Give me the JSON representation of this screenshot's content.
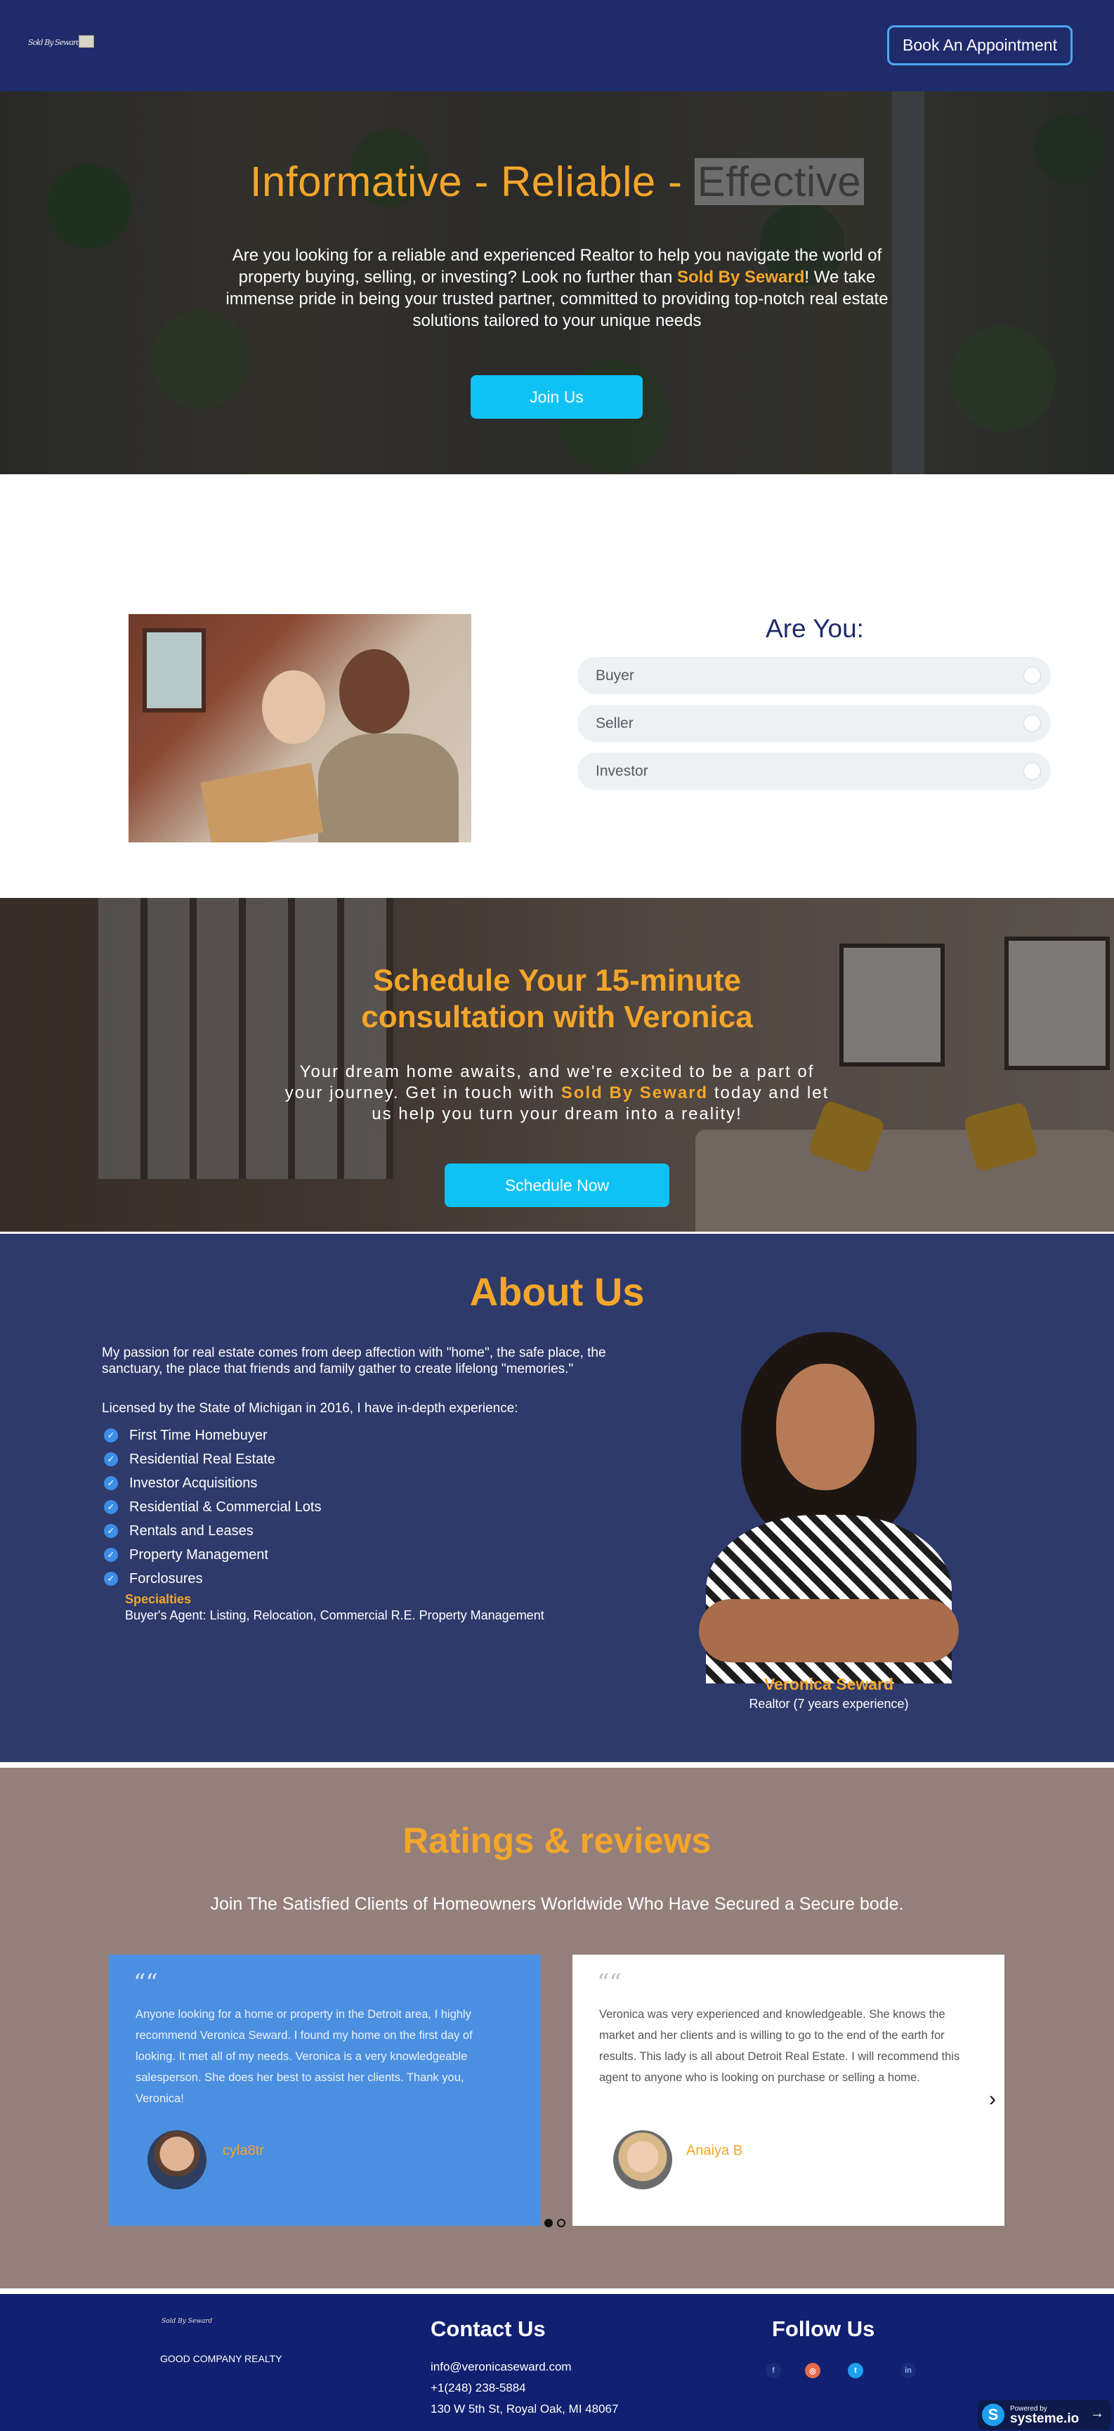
{
  "header": {
    "logo_text": "Sold By Seward",
    "book_label": "Book An Appointment"
  },
  "hero": {
    "title_part1": "Informative - Reliable - ",
    "title_highlight": "Effective",
    "text_before": "Are you looking for a reliable and experienced Realtor to help you navigate the world of property buying, selling, or investing? Look no further than ",
    "brand": "Sold By Seward",
    "text_after": "! We take immense pride in being your trusted partner, committed to providing top-notch real estate solutions tailored to your unique needs",
    "join_label": "Join Us"
  },
  "are_you": {
    "title": "Are You:",
    "options": [
      "Buyer",
      "Seller",
      "Investor"
    ]
  },
  "schedule": {
    "title_line1": "Schedule Your 15-minute",
    "title_line2": "consultation with Veronica",
    "text_before": "Your dream home awaits, and we're excited to be a part of your journey. Get in touch with ",
    "brand": "Sold By Seward",
    "text_after": " today and let us help you turn your dream into a reality!",
    "button_label": "Schedule Now"
  },
  "about": {
    "title": "About Us",
    "paragraph": "My passion for real estate comes from deep affection with \"home\", the safe place, the sanctuary, the place that friends and family gather to create lifelong \"memories.\"",
    "licensed": "Licensed by the State of Michigan in 2016, I have in-depth experience:",
    "items": [
      "First Time Homebuyer",
      "Residential Real Estate",
      "Investor Acquisitions",
      "Residential & Commercial Lots",
      "Rentals and Leases",
      "Property Management",
      "Forclosures"
    ],
    "specialties_label": "Specialties",
    "specialties_text": "Buyer's Agent: Listing, Relocation, Commercial R.E. Property Management",
    "name": "Veronica Seward",
    "role": "Realtor (7 years experience)"
  },
  "ratings": {
    "title": "Ratings & reviews",
    "subtitle": "Join The Satisfied Clients of Homeowners Worldwide Who Have Secured a Secure bode.",
    "reviews": [
      {
        "text": "Anyone looking for a home or property in the Detroit area, I highly recommend Veronica Seward. I found my home on the first day of looking. It met all of my needs. Veronica is a very knowledgeable salesperson. She does her best to assist her clients. Thank you, Veronica!",
        "name": "cyla8tr"
      },
      {
        "text": "Veronica was very experienced and knowledgeable. She knows the market and her clients and is willing to go to the end of the earth for results. This lady is all about Detroit Real Estate. I will recommend this agent to anyone who is looking on purchase or selling a home.",
        "name": "Anaiya B"
      }
    ],
    "quote_mark": "““"
  },
  "footer": {
    "logo_text": "Sold By Seward",
    "company": "GOOD COMPANY REALTY",
    "contact_title": "Contact Us",
    "email": "info@veronicaseward.com",
    "phone": "+1(248) 238-5884",
    "address": "130 W 5th St, Royal Oak, MI 48067",
    "follow_title": "Follow Us",
    "powered_small": "Powered by",
    "powered_big": "systeme.io"
  },
  "colors": {
    "navy": "#202b6b",
    "accent_orange": "#f4a62a",
    "cyan_button": "#0fc2f5",
    "about_bg": "#2e3a6b",
    "ratings_bg": "#947f7b",
    "footer_bg": "#112070"
  },
  "icons": [
    "check-icon",
    "quote-icon",
    "chevron-right-icon",
    "facebook-icon",
    "instagram-icon",
    "twitter-icon",
    "linkedin-icon"
  ]
}
